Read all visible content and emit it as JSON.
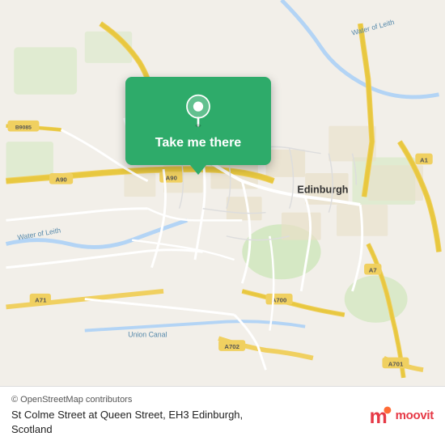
{
  "map": {
    "background_color": "#f2efe9"
  },
  "location_card": {
    "label": "Take me there",
    "pin_color": "#fff"
  },
  "bottom_bar": {
    "osm_credit": "© OpenStreetMap contributors",
    "address_line1": "St Colme Street at Queen Street, EH3 Edinburgh,",
    "address_line2": "Scotland"
  },
  "moovit": {
    "logo_text": "moovit"
  }
}
